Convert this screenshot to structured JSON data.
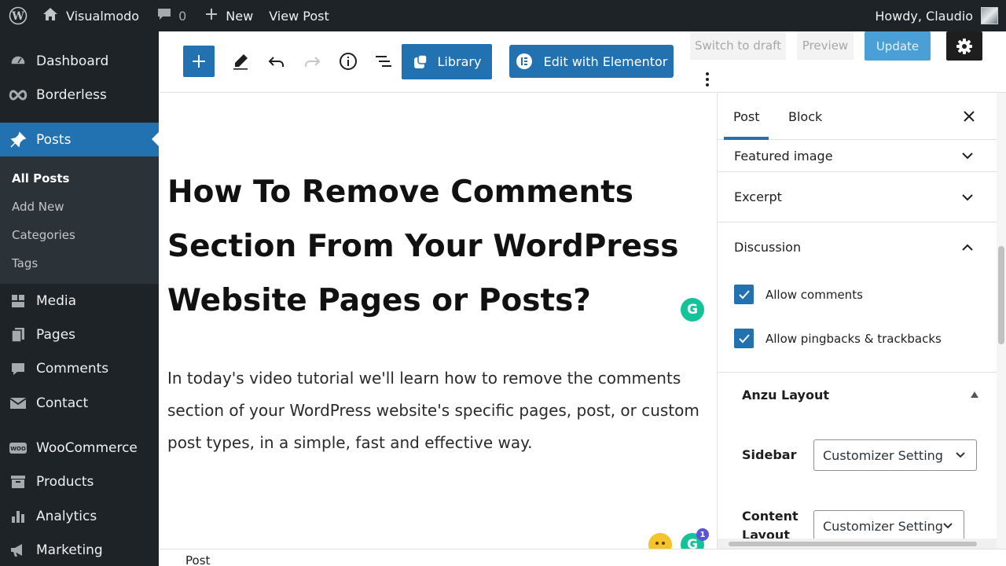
{
  "adminbar": {
    "site_name": "Visualmodo",
    "comments_count": "0",
    "new_label": "New",
    "view_post_label": "View Post",
    "howdy": "Howdy, Claudio"
  },
  "sidebar": {
    "items": [
      {
        "label": "Dashboard",
        "icon": "dashboard-icon"
      },
      {
        "label": "Borderless",
        "icon": "infinity-icon"
      },
      {
        "label": "Posts",
        "icon": "pin-icon"
      },
      {
        "label": "Media",
        "icon": "media-icon"
      },
      {
        "label": "Pages",
        "icon": "pages-icon"
      },
      {
        "label": "Comments",
        "icon": "comment-icon"
      },
      {
        "label": "Contact",
        "icon": "mail-icon"
      },
      {
        "label": "WooCommerce",
        "icon": "woo-icon"
      },
      {
        "label": "Products",
        "icon": "archive-icon"
      },
      {
        "label": "Analytics",
        "icon": "bar-chart-icon"
      },
      {
        "label": "Marketing",
        "icon": "megaphone-icon"
      }
    ],
    "submenu": [
      "All Posts",
      "Add New",
      "Categories",
      "Tags"
    ],
    "active_color": "#2271b1"
  },
  "toolbar": {
    "library_label": "Library",
    "elementor_label": "Edit with Elementor",
    "switch_draft_label": "Switch to draft",
    "preview_label": "Preview",
    "update_label": "Update"
  },
  "post": {
    "title": "How To Remove Comments Section From Your WordPress Website Pages or Posts?",
    "paragraph": "In today's video tutorial we'll learn how to remove the comments section of your WordPress website's specific pages, post, or custom post types, in a simple, fast and effective way.",
    "grammarly_badge": "1"
  },
  "settings": {
    "tab_post": "Post",
    "tab_block": "Block",
    "featured_image": "Featured image",
    "excerpt": "Excerpt",
    "discussion": "Discussion",
    "allow_comments": "Allow comments",
    "allow_pingbacks": "Allow pingbacks & trackbacks",
    "anzu_layout": "Anzu Layout",
    "sidebar_label": "Sidebar",
    "sidebar_value": "Customizer Setting",
    "content_layout_label": "Content Layout",
    "content_layout_value": "Customizer Setting"
  },
  "footer": {
    "breadcrumb": "Post"
  }
}
